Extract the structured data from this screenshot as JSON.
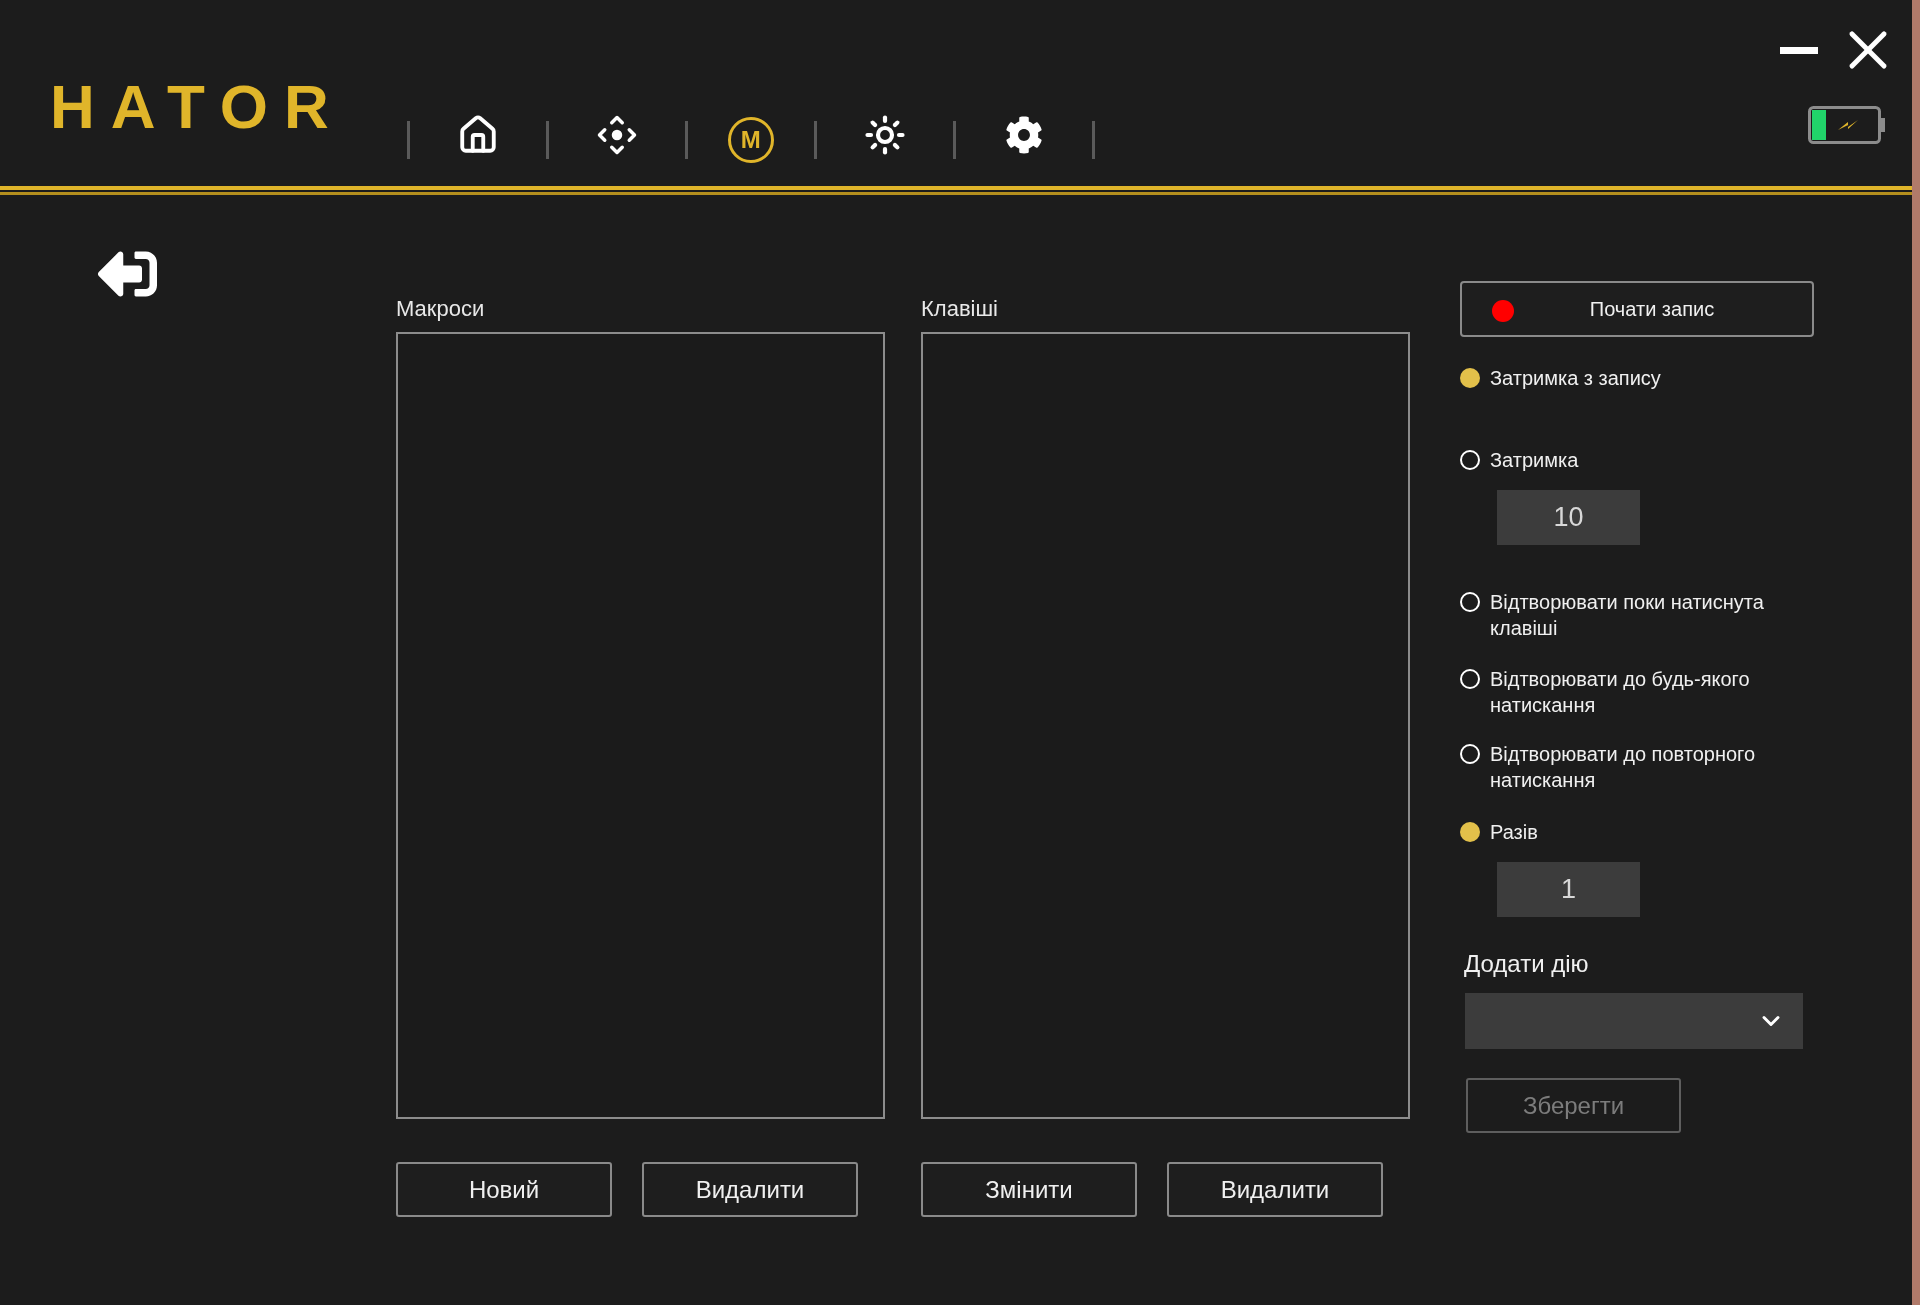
{
  "logo": "HATOR",
  "nav": [
    {
      "kind": "home",
      "selected": false
    },
    {
      "kind": "move",
      "selected": false
    },
    {
      "kind": "macro",
      "label": "M",
      "selected": true
    },
    {
      "kind": "lighting",
      "selected": false
    },
    {
      "kind": "settings",
      "selected": false
    }
  ],
  "macros": {
    "title": "Макроси",
    "buttons": [
      "Новий",
      "Видалити"
    ]
  },
  "keys": {
    "title": "Клавіші",
    "buttons": [
      "Змінити",
      "Видалити"
    ]
  },
  "record_button": "Почати запис",
  "options": [
    {
      "label": "Затримка з запису",
      "selected": true
    },
    {
      "label": "Затримка",
      "selected": false,
      "value": "10"
    },
    {
      "label": "Відтворювати поки натиснута клавіші",
      "selected": false
    },
    {
      "label": "Відтворювати до будь-якого натискання",
      "selected": false
    },
    {
      "label": "Відтворювати до повторного натискання",
      "selected": false
    },
    {
      "label": "Разів",
      "selected": true,
      "value": "1"
    }
  ],
  "add_action": {
    "label": "Додати дію"
  },
  "save_button": {
    "label": "Зберегти",
    "disabled": true
  }
}
